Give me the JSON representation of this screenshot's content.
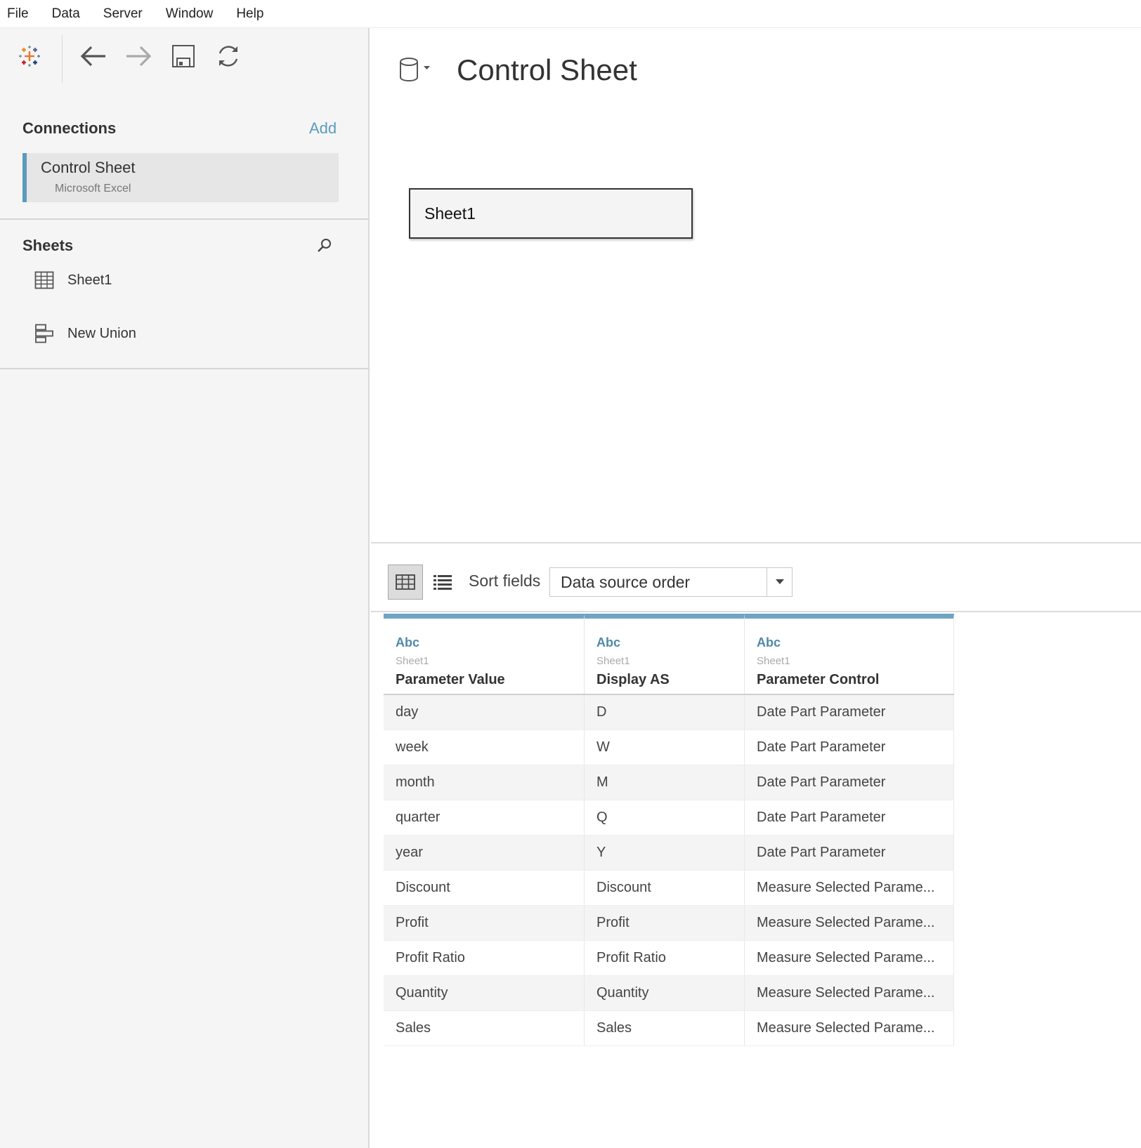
{
  "menu": [
    "File",
    "Data",
    "Server",
    "Window",
    "Help"
  ],
  "toolbar": {
    "icons": [
      "tableau-logo-icon",
      "back-arrow-icon",
      "forward-arrow-icon",
      "save-icon",
      "refresh-icon"
    ]
  },
  "connections": {
    "title": "Connections",
    "add_label": "Add",
    "items": [
      {
        "name": "Control Sheet",
        "type": "Microsoft Excel"
      }
    ]
  },
  "sheets": {
    "title": "Sheets",
    "items": [
      {
        "label": "Sheet1",
        "icon": "table-icon"
      },
      {
        "label": "New Union",
        "icon": "union-icon"
      }
    ]
  },
  "canvas": {
    "datasource_title": "Control Sheet",
    "table_label": "Sheet1"
  },
  "grid_toolbar": {
    "sort_label": "Sort fields",
    "sort_value": "Data source order"
  },
  "grid": {
    "columns": [
      {
        "type": "Abc",
        "source": "Sheet1",
        "name": "Parameter Value"
      },
      {
        "type": "Abc",
        "source": "Sheet1",
        "name": "Display AS"
      },
      {
        "type": "Abc",
        "source": "Sheet1",
        "name": "Parameter Control"
      }
    ],
    "rows": [
      [
        "day",
        "D",
        "Date Part Parameter"
      ],
      [
        "week",
        "W",
        "Date Part Parameter"
      ],
      [
        "month",
        "M",
        "Date Part Parameter"
      ],
      [
        "quarter",
        "Q",
        "Date Part Parameter"
      ],
      [
        "year",
        "Y",
        "Date Part Parameter"
      ],
      [
        "Discount",
        "Discount",
        "Measure Selected Parame..."
      ],
      [
        "Profit",
        "Profit",
        "Measure Selected Parame..."
      ],
      [
        "Profit Ratio",
        "Profit Ratio",
        "Measure Selected Parame..."
      ],
      [
        "Quantity",
        "Quantity",
        "Measure Selected Parame..."
      ],
      [
        "Sales",
        "Sales",
        "Measure Selected Parame..."
      ]
    ]
  },
  "colors": {
    "accent": "#5b9bbd",
    "header_bar": "#6fa4c4",
    "type_label": "#4f89a8"
  }
}
